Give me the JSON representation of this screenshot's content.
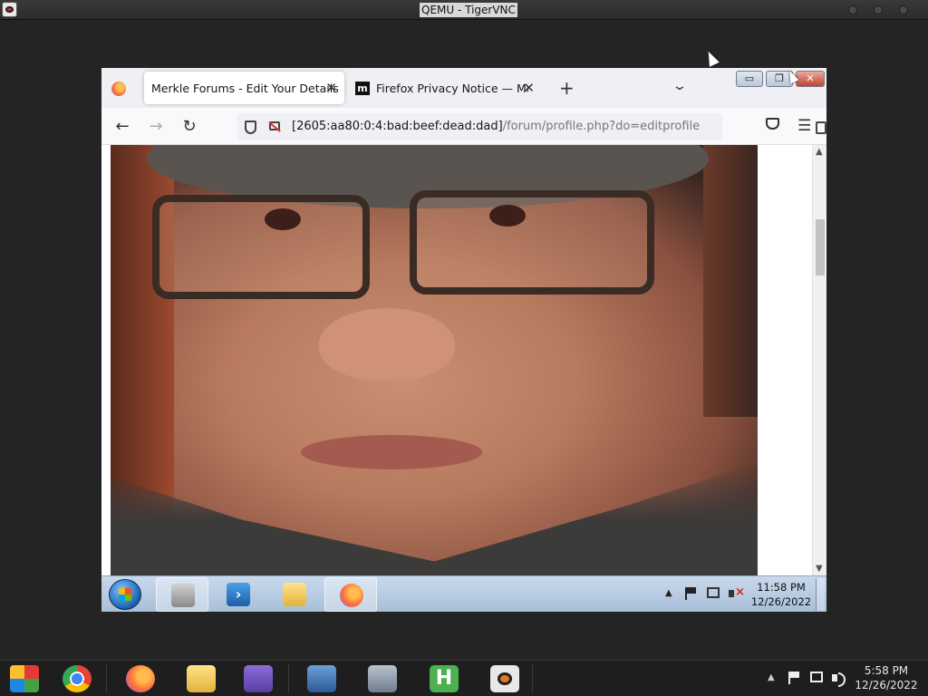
{
  "host": {
    "window_title": "QEMU - TigerVNC",
    "clock": {
      "time": "5:58 PM",
      "date": "12/26/2022"
    }
  },
  "browser": {
    "tabs": [
      {
        "label": "Merkle Forums - Edit Your Details",
        "active": true
      },
      {
        "label": "Firefox Privacy Notice — Mozilla",
        "active": false,
        "favicon": "m"
      }
    ],
    "new_tab": "+",
    "url": {
      "host": "[2605:aa80:0:4:bad:beef:dead:dad]",
      "path": "/forum/profile.php?do=editprofile"
    },
    "window_controls": {
      "minimize": "▭",
      "maximize": "❐",
      "close": "✕"
    }
  },
  "page": {
    "profile_photo": "close-up portrait of a man wearing glasses"
  },
  "guest_taskbar": {
    "clock": {
      "time": "11:58 PM",
      "date": "12/26/2022"
    }
  },
  "icons": {
    "nav": [
      "back-arrow-icon",
      "forward-arrow-icon",
      "reload-icon"
    ],
    "url": [
      "shield-icon",
      "insecure-lock-icon",
      "reader-view-icon",
      "bookmark-star-icon"
    ],
    "toolbar": [
      "pocket-icon",
      "hamburger-menu-icon"
    ],
    "guest_taskbar": [
      "start-orb-icon",
      "server-manager-icon",
      "powershell-icon",
      "file-explorer-icon",
      "firefox-icon"
    ],
    "host_taskbar": [
      "photos-icon",
      "chrome-icon",
      "firefox-icon",
      "file-manager-icon",
      "network-icon",
      "remote-desktop-icon",
      "installer-icon",
      "hexchat-icon",
      "tigervnc-icon"
    ]
  },
  "colors": {
    "guest_taskbar": "#b9cde4",
    "close_button": "#c2432c",
    "host_taskbar": "#1e1e1e"
  }
}
